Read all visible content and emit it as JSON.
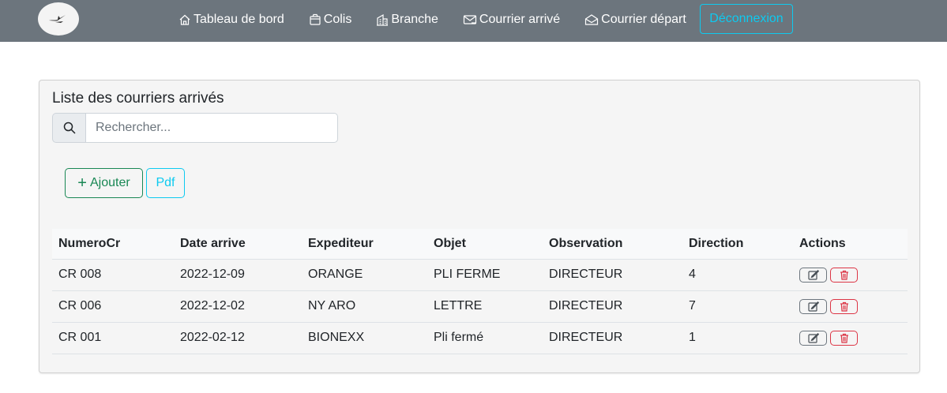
{
  "nav": {
    "links": [
      {
        "label": "Tableau de bord",
        "icon": "house-icon"
      },
      {
        "label": "Colis",
        "icon": "package-icon"
      },
      {
        "label": "Branche",
        "icon": "building-icon"
      },
      {
        "label": "Courrier arrivé",
        "icon": "mail-in-icon"
      },
      {
        "label": "Courrier départ",
        "icon": "mail-open-icon"
      }
    ],
    "logout_label": "Déconnexion"
  },
  "card": {
    "title": "Liste des courriers arrivés",
    "search_placeholder": "Rechercher...",
    "add_label": "Ajouter",
    "pdf_label": "Pdf"
  },
  "table": {
    "headers": [
      "NumeroCr",
      "Date arrive",
      "Expediteur",
      "Objet",
      "Observation",
      "Direction",
      "Actions"
    ],
    "rows": [
      [
        "CR 008",
        "2022-12-09",
        "ORANGE",
        "PLI FERME",
        "DIRECTEUR",
        "4"
      ],
      [
        "CR 006",
        "2022-12-02",
        "NY ARO",
        "LETTRE",
        "DIRECTEUR",
        "7"
      ],
      [
        "CR 001",
        "2022-02-12",
        "BIONEXX",
        "Pli fermé",
        "DIRECTEUR",
        "1"
      ]
    ]
  },
  "colors": {
    "navbar": "#6c757d",
    "info": "#0dcaf0",
    "success": "#198754",
    "danger": "#dc3545"
  }
}
